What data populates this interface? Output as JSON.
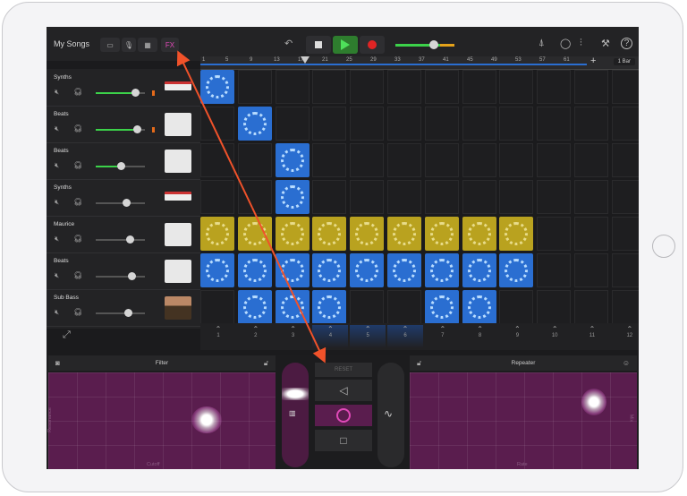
{
  "topbar": {
    "my_songs": "My Songs",
    "fx_label": "FX",
    "bar_length": "1 Bar"
  },
  "ruler": {
    "ticks": [
      "1",
      "5",
      "9",
      "13",
      "17",
      "21",
      "25",
      "29",
      "33",
      "37",
      "41",
      "45",
      "49",
      "53",
      "57",
      "61"
    ]
  },
  "tracks": [
    {
      "name": "Synths",
      "icon": "keyboard-icon"
    },
    {
      "name": "Beats",
      "icon": "drum-machine-icon"
    },
    {
      "name": "Beats",
      "icon": "drum-machine-icon"
    },
    {
      "name": "Synths",
      "icon": "keyboard-icon"
    },
    {
      "name": "Maurice",
      "icon": "drum-machine-icon"
    },
    {
      "name": "Beats",
      "icon": "drum-machine-icon"
    },
    {
      "name": "Sub Bass",
      "icon": "bass-synth-icon"
    }
  ],
  "scenes": [
    "1",
    "2",
    "3",
    "4",
    "5",
    "6",
    "7",
    "8",
    "9",
    "10",
    "11",
    "12"
  ],
  "fx": {
    "left_pad_title": "Filter",
    "left_pad_xlabel": "Cutoff",
    "left_pad_ylabel": "Resonance",
    "right_pad_title": "Repeater",
    "right_pad_xlabel": "Rate",
    "right_pad_ylabel": "Mix",
    "reset_label": "RESET"
  },
  "colors": {
    "accent_green": "#3cd24a",
    "record_red": "#e02424",
    "clip_blue": "#2a6ed1",
    "clip_gold": "#b9a21f",
    "fx_purple": "#5a1d4e",
    "arrow": "#f0522a"
  }
}
